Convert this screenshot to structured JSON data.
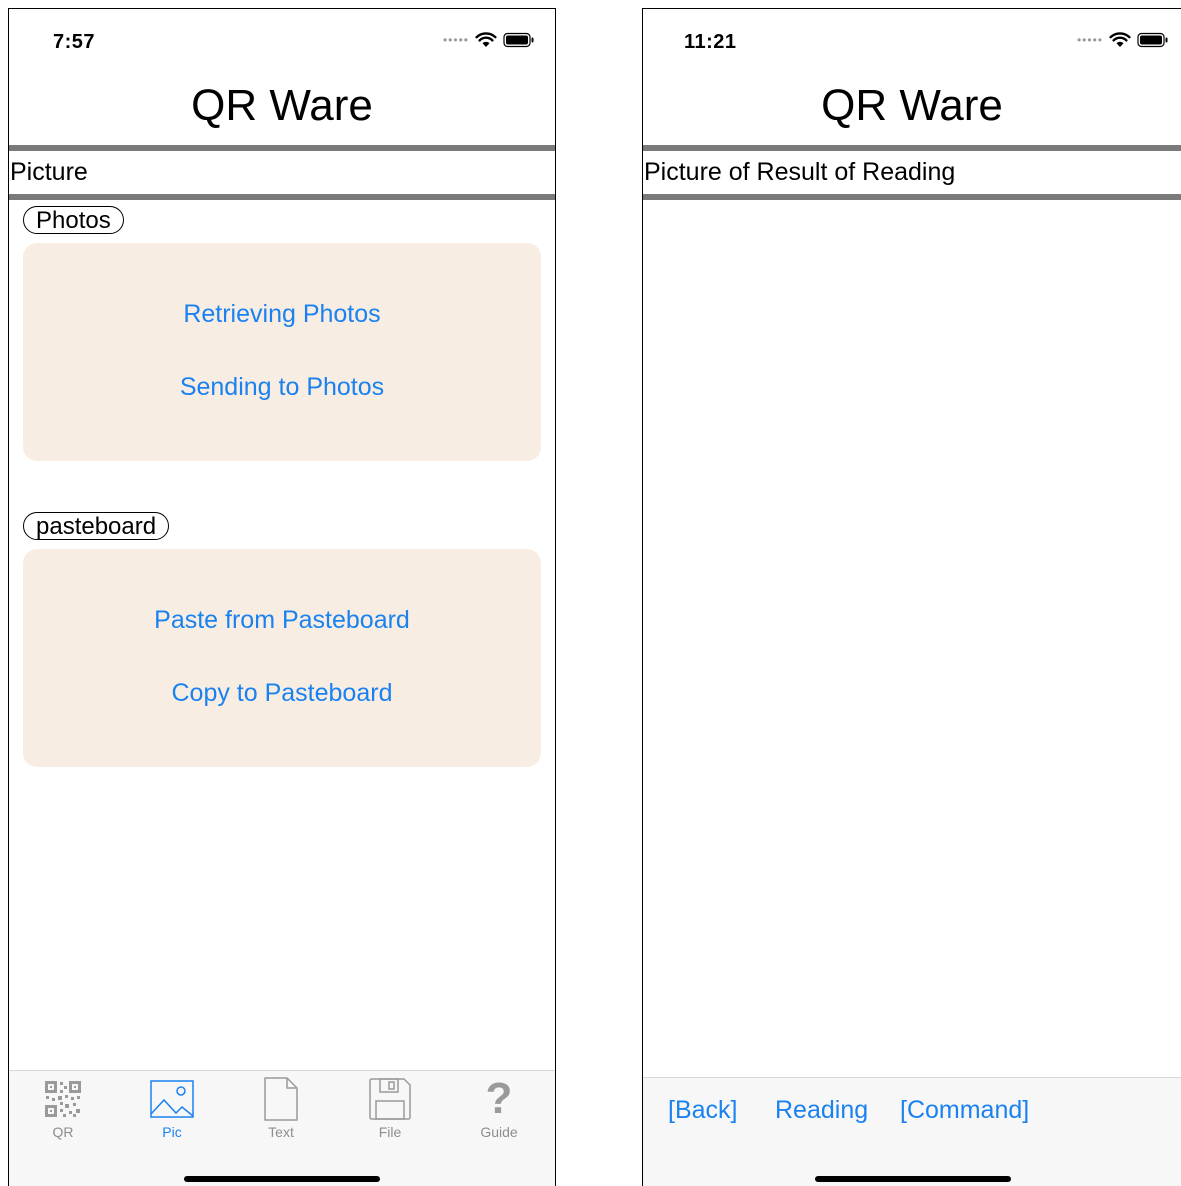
{
  "left_screen": {
    "status": {
      "time": "7:57"
    },
    "app_title": "QR Ware",
    "section_title": "Picture",
    "photos": {
      "label": "Photos",
      "retrieve": "Retrieving Photos",
      "send": "Sending to Photos"
    },
    "pasteboard": {
      "label": "pasteboard",
      "paste": "Paste from Pasteboard",
      "copy": "Copy to Pasteboard"
    },
    "tabs": [
      {
        "label": "QR",
        "icon": "qr-code-icon"
      },
      {
        "label": "Pic",
        "icon": "picture-icon",
        "active": true
      },
      {
        "label": "Text",
        "icon": "document-icon"
      },
      {
        "label": "File",
        "icon": "floppy-disk-icon"
      },
      {
        "label": "Guide",
        "icon": "question-mark-icon"
      }
    ]
  },
  "right_screen": {
    "status": {
      "time": "11:21"
    },
    "app_title": "QR Ware",
    "section_title": "Picture of Result of Reading",
    "toolbar": {
      "back": "[Back]",
      "reading": "Reading",
      "command": "[Command]"
    }
  },
  "colors": {
    "accent": "#1a82f0",
    "panel_bg": "#f8ede2",
    "section_border": "#7a7a7a",
    "tab_inactive": "#8e8e8e"
  }
}
